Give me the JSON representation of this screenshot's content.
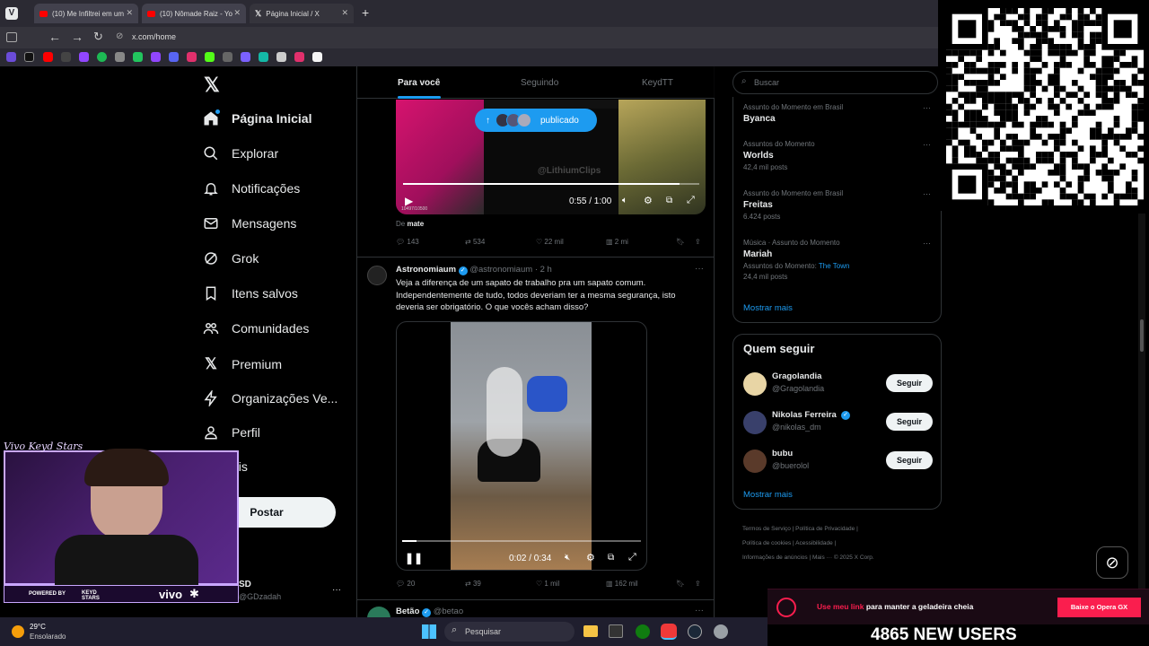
{
  "browser": {
    "tabs": [
      {
        "title": "(10) Me Infiltrei em um"
      },
      {
        "title": "(10) Nômade Raiz - Yo"
      },
      {
        "title": "Página Inicial / X"
      }
    ],
    "new_tab": "+",
    "url": "x.com/home"
  },
  "nav": {
    "items": [
      {
        "label": "Página Inicial",
        "icon": "home-icon"
      },
      {
        "label": "Explorar",
        "icon": "search-icon"
      },
      {
        "label": "Notificações",
        "icon": "bell-icon"
      },
      {
        "label": "Mensagens",
        "icon": "mail-icon"
      },
      {
        "label": "Grok",
        "icon": "grok-icon"
      },
      {
        "label": "Itens salvos",
        "icon": "bookmark-icon"
      },
      {
        "label": "Comunidades",
        "icon": "people-icon"
      },
      {
        "label": "Premium",
        "icon": "x-logo-icon"
      },
      {
        "label": "Organizações Ve...",
        "icon": "bolt-icon"
      },
      {
        "label": "Perfil",
        "icon": "person-icon"
      },
      {
        "label": "ais",
        "icon": "more-icon"
      }
    ],
    "post_button": "Postar",
    "account_name": "SD",
    "account_handle": "@GDzadah",
    "account_more": "···"
  },
  "feed": {
    "tabs": [
      "Para você",
      "Seguindo",
      "KeydTT"
    ],
    "tweet1": {
      "video_time": "0:55 / 1:00",
      "badge": "publicado",
      "watermark": "@LithiumClips",
      "video_small": "10497/10500",
      "from_prefix": "De",
      "from_name": "mate",
      "replies": "143",
      "retweets": "534",
      "likes": "22 mil",
      "views": "2 mi"
    },
    "tweet2": {
      "name": "Astronomiaum",
      "handle": "@astronomiaum",
      "dot": "·",
      "time": "2 h",
      "more": "···",
      "text": "Veja a diferença de um sapato de trabalho pra um sapato comum. Independentemente de tudo, todos deveriam ter a mesma segurança, isto deveria ser obrigatório. O que vocês acham disso?",
      "video_time": "0:02 / 0:34",
      "video_progress": 0.06,
      "replies": "20",
      "retweets": "39",
      "likes": "1 mil",
      "views": "162 mil"
    },
    "tweet3": {
      "name": "Betão",
      "handle": "@betao",
      "more": "···"
    }
  },
  "right": {
    "search_placeholder": "Buscar",
    "trends": [
      {
        "context": "Assunto do Momento em Brasil",
        "title": "Byanca",
        "posts": ""
      },
      {
        "context": "Assuntos do Momento",
        "title": "Worlds",
        "posts": "42,4 mil posts"
      },
      {
        "context": "Assunto do Momento em Brasil",
        "title": "Freitas",
        "posts": "6.424 posts"
      },
      {
        "context": "Música · Assunto do Momento",
        "title": "Mariah",
        "extra_prefix": "Assuntos do Momento:",
        "extra_link": "The Town",
        "posts": "24,4 mil posts"
      }
    ],
    "show_more": "Mostrar mais",
    "who_to_follow_title": "Quem seguir",
    "follow": [
      {
        "name": "Gragolandia",
        "handle": "@Gragolandia",
        "verified": false
      },
      {
        "name": "Nikolas Ferreira",
        "handle": "@nikolas_dm",
        "verified": true
      },
      {
        "name": "bubu",
        "handle": "@buerolol",
        "verified": false
      }
    ],
    "follow_button": "Seguir",
    "show_more2": "Mostrar mais",
    "footer": [
      "Termos de Serviço",
      "|",
      "Política de Privacidade",
      "|",
      "Política de cookies",
      "|",
      "Acessibilidade",
      "|",
      "Informações de anúncios",
      "|",
      "Mais ···",
      "© 2025 X Corp."
    ]
  },
  "stream": {
    "logo_text": "Vivo Keyd Stars",
    "powered": "POWERED BY",
    "brand_keyd": "KEYD STARS",
    "brand_vivo": "vivo",
    "opera_text_highlight": "Use meu link",
    "opera_text": "para manter a geladeira cheia",
    "opera_button": "Baixe o Opera GX",
    "users_banner": "4865 NEW USERS"
  },
  "taskbar": {
    "temp": "29°C",
    "weather": "Ensolarado",
    "search": "Pesquisar"
  },
  "colors": {
    "accent": "#1d9bf0",
    "bg": "#000000",
    "border": "#2f3336",
    "muted": "#71767b"
  }
}
